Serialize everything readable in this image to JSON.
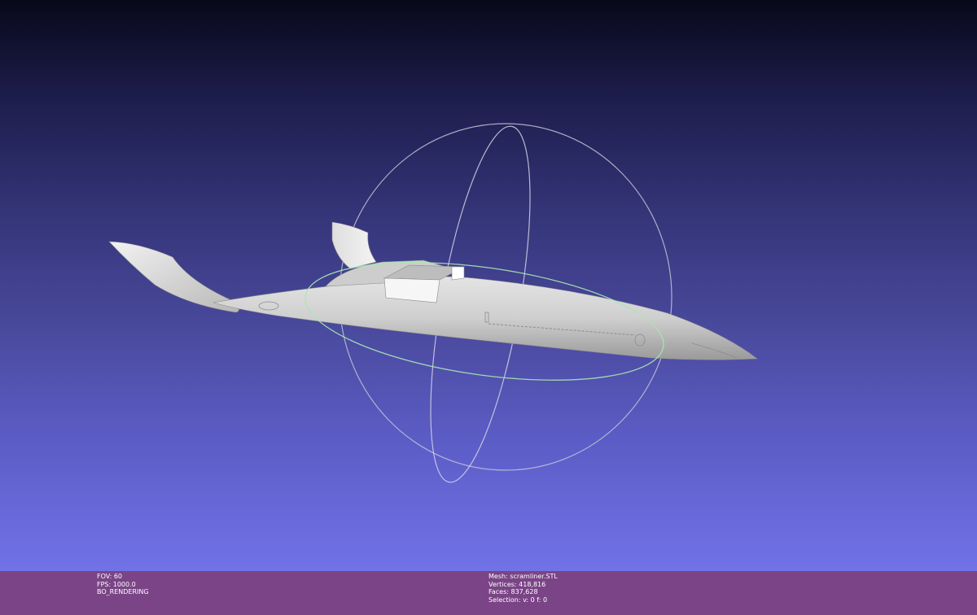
{
  "viewport": {
    "background_top": "#08081a",
    "background_bottom": "#7272e8"
  },
  "status_bar": {
    "background": "#7a4486",
    "left": {
      "fov": "FOV: 60",
      "fps": "FPS:  1000.0",
      "render_mode": "BO_RENDERING"
    },
    "right": {
      "mesh": "Mesh: scramliner.STL",
      "vertices": "Vertices: 418,816",
      "faces": "Faces: 837,628",
      "selection": "Selection: v: 0 f: 0"
    }
  },
  "trackball": {
    "ring_horizontal_color": "#a8e6b4",
    "ring_color": "#c8c8dc"
  }
}
